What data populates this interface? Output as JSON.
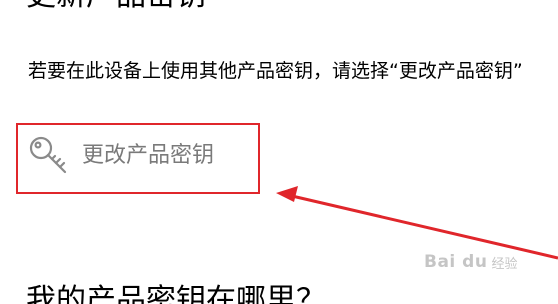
{
  "section_title": "更新产品密钥",
  "description": "若要在此设备上使用其他产品密钥，请选择“更改产品密钥”",
  "change_key": {
    "label": "更改产品密钥",
    "icon": "key-icon"
  },
  "next_section_title": "我的产品密钥在哪里？",
  "watermark": {
    "logo_text": "Bai du",
    "sub_text": "经验"
  },
  "colors": {
    "annotation": "#e0262b",
    "link_gray": "#7a7a7a"
  }
}
